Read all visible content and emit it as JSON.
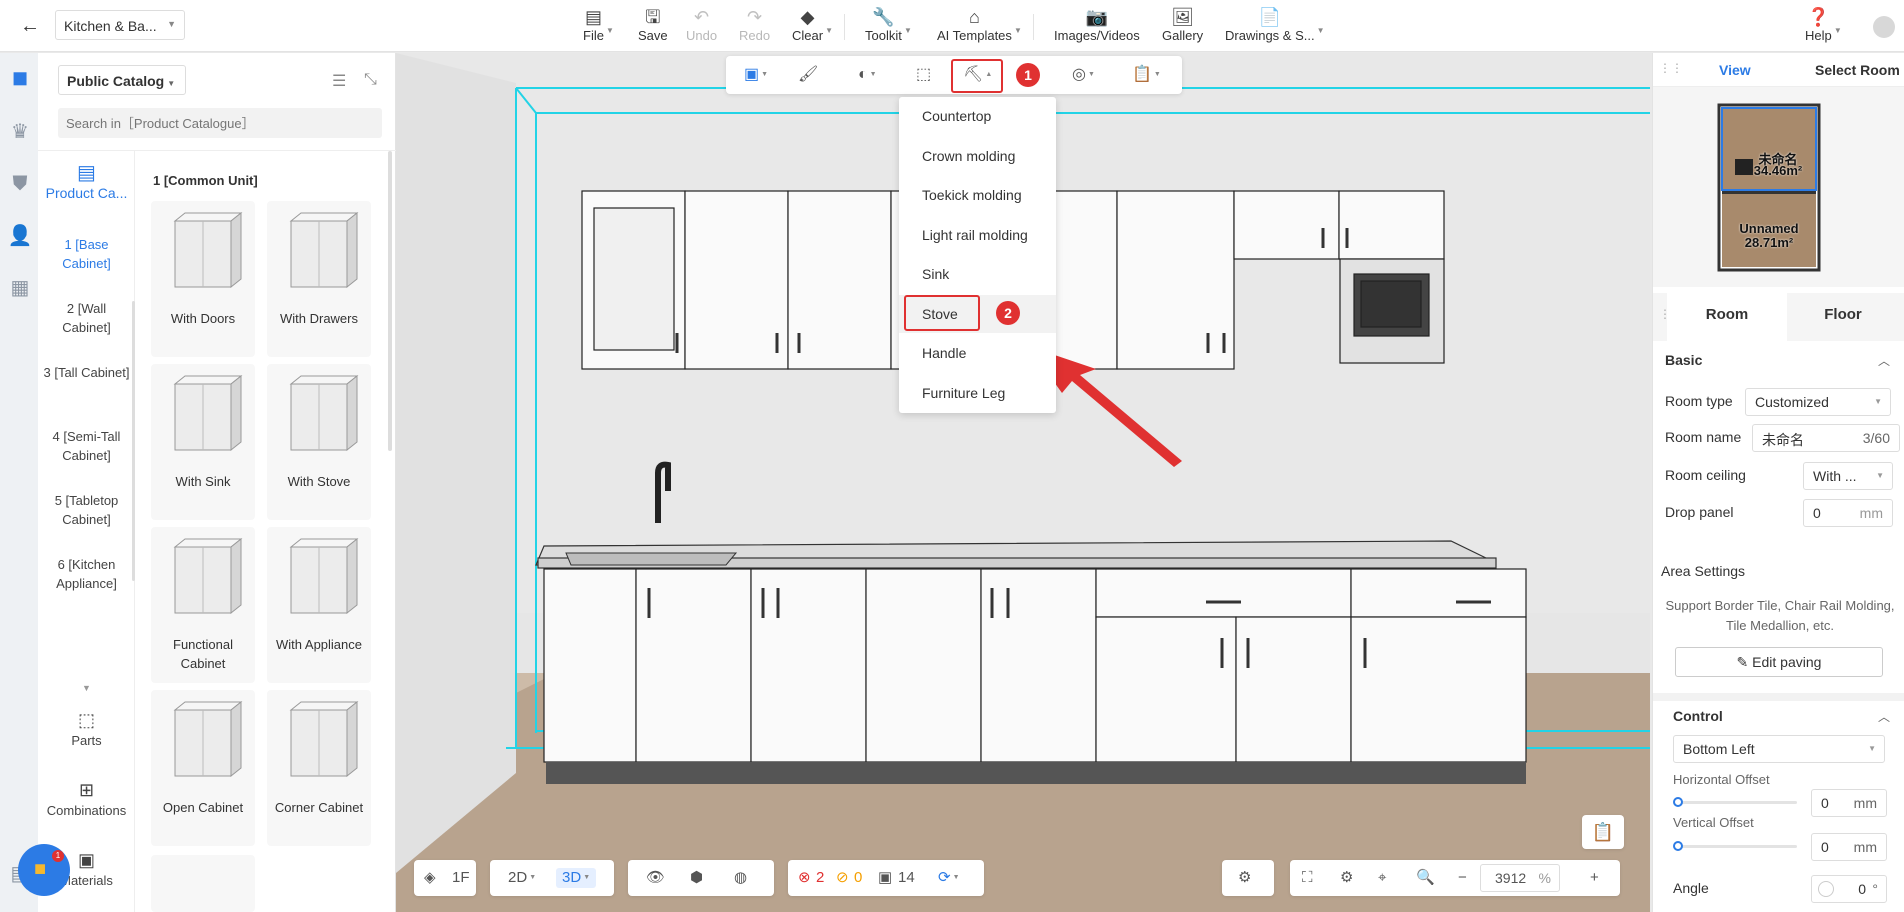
{
  "topbar": {
    "back_icon": "arrow-left-icon",
    "doc_title": "Kitchen & Ba...",
    "file": "File",
    "save": "Save",
    "undo": "Undo",
    "redo": "Redo",
    "clear": "Clear",
    "toolkit": "Toolkit",
    "ai_templates": "AI Templates",
    "images_videos": "Images/Videos",
    "gallery": "Gallery",
    "drawings": "Drawings & S...",
    "help": "Help"
  },
  "catalog": {
    "source": "Public Catalog",
    "search_placeholder": "Search in［Product Catalogue］",
    "nav_tab": "Product Ca...",
    "nav_items": [
      {
        "label": "1 [Base Cabinet]",
        "active": true
      },
      {
        "label": "2 [Wall Cabinet]",
        "active": false
      },
      {
        "label": "3 [Tall Cabinet]",
        "active": false
      },
      {
        "label": "4 [Semi-Tall Cabinet]",
        "active": false
      },
      {
        "label": "5 [Tabletop Cabinet]",
        "active": false
      },
      {
        "label": "6 [Kitchen Appliance]",
        "active": false
      }
    ],
    "bottom_items": [
      "Parts",
      "Combinations",
      "Materials"
    ],
    "group_title": "1 [Common Unit]",
    "products": [
      "With Doors",
      "With Drawers",
      "With Sink",
      "With Stove",
      "Functional Cabinet",
      "With Appliance",
      "Open Cabinet",
      "Corner Cabinet"
    ]
  },
  "floating_toolbar": {
    "annotation_badge_1": "1"
  },
  "dropdown_menu": {
    "items": [
      "Countertop",
      "Crown molding",
      "Toekick molding",
      "Light rail molding",
      "Sink",
      "Stove",
      "Handle",
      "Furniture Leg"
    ],
    "selected": "Stove",
    "annotation_badge_2": "2"
  },
  "bottom_bar": {
    "floor": "1F",
    "mode_2d": "2D",
    "mode_3d": "3D",
    "errors": "2",
    "warnings": "0",
    "items_count": "14",
    "zoom": "3912",
    "zoom_unit": "%"
  },
  "right_panel": {
    "view_tab": "View",
    "select_room_tab": "Select Room",
    "minimap_room1_name": "未命名",
    "minimap_room1_area": "34.46m²",
    "minimap_room2_name": "Unnamed",
    "minimap_room2_area": "28.71m²",
    "tab_room": "Room",
    "tab_floor": "Floor",
    "basic": "Basic",
    "room_type_label": "Room type",
    "room_type_value": "Customized",
    "room_name_label": "Room name",
    "room_name_value": "未命名",
    "room_name_count": "3/60",
    "room_ceiling_label": "Room ceiling",
    "room_ceiling_value": "With ...",
    "drop_panel_label": "Drop panel",
    "drop_panel_value": "0",
    "drop_panel_unit": "mm",
    "area_settings": "Area Settings",
    "area_note": "Support Border Tile, Chair Rail Molding, Tile Medallion, etc.",
    "edit_paving": "Edit paving",
    "control": "Control",
    "anchor_value": "Bottom Left",
    "h_offset_label": "Horizontal Offset",
    "h_offset_value": "0",
    "h_offset_unit": "mm",
    "v_offset_label": "Vertical Offset",
    "v_offset_value": "0",
    "v_offset_unit": "mm",
    "angle_label": "Angle",
    "angle_value": "0",
    "angle_unit": "°"
  },
  "chat": {
    "unread": "1"
  },
  "colors": {
    "accent": "#2c7be5",
    "annotation": "#e03131",
    "selection": "#22d3e6"
  }
}
